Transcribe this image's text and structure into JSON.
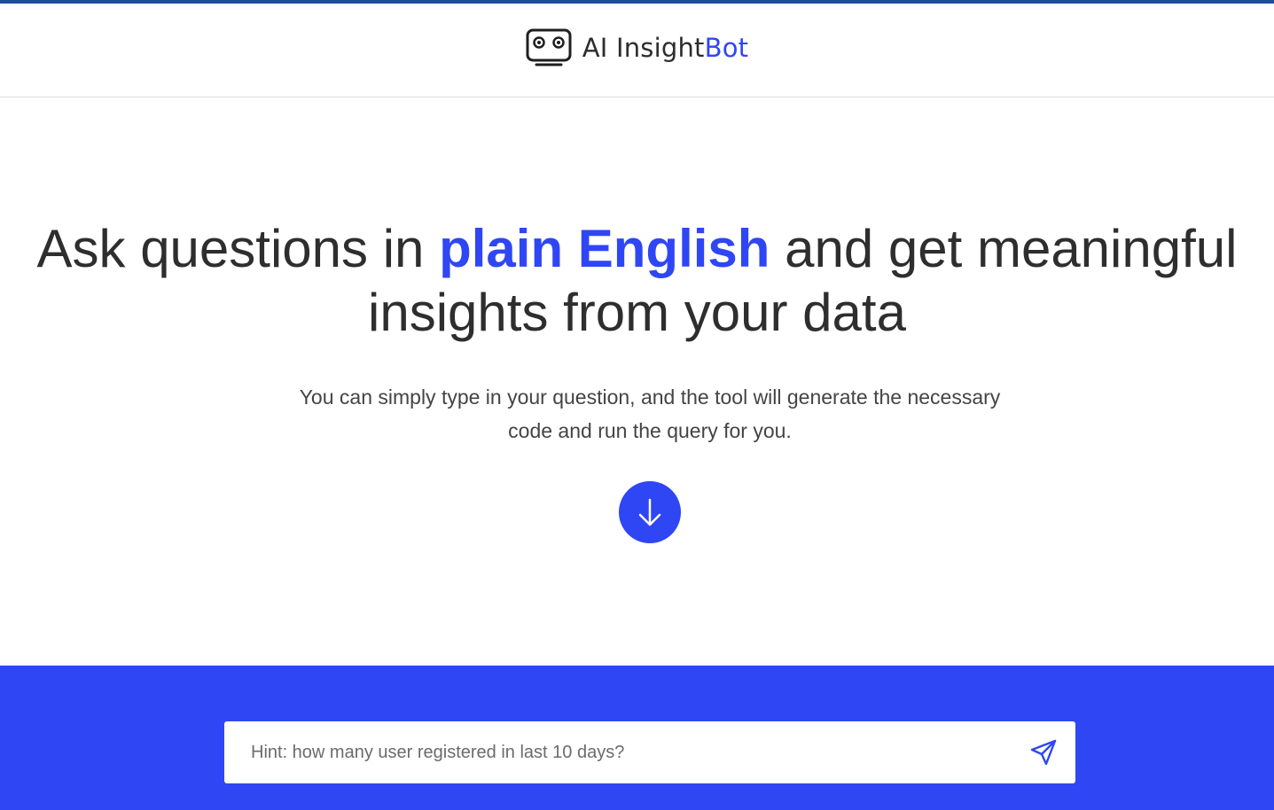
{
  "header": {
    "brand_prefix": "AI Insight",
    "brand_suffix": "Bot",
    "logo_icon": "robot-face-icon"
  },
  "hero": {
    "headline_part1": "Ask questions in ",
    "headline_highlight": "plain English",
    "headline_part2": " and get meaningful insights from your data",
    "subtext": "You can simply type in your question, and the tool will generate the necessary code and run the query for you.",
    "scroll_icon": "arrow-down-icon"
  },
  "query": {
    "placeholder": "Hint: how many user registered in last 10 days?",
    "value": "",
    "send_icon": "send-icon"
  },
  "colors": {
    "accent": "#2f46f5",
    "top_bar": "#1d4e9c",
    "text": "#2e2e2e"
  }
}
